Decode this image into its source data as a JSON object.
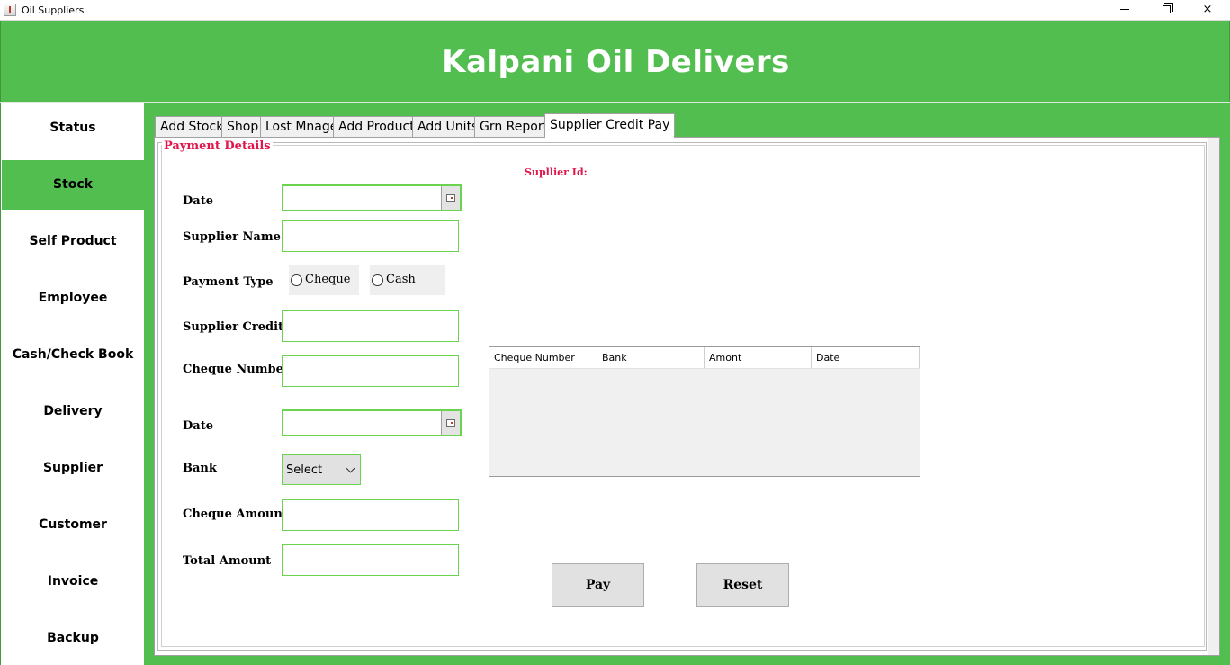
{
  "window": {
    "title": "Oil Suppliers",
    "controls": {
      "minimize": "minimize-icon",
      "maximize": "restore-icon",
      "close": "×"
    }
  },
  "header": {
    "title": "Kalpani Oil Delivers"
  },
  "colors": {
    "brand_green": "#52be4f",
    "accent_red": "#e0174a",
    "field_border": "#6ad34f"
  },
  "sidebar": {
    "items": [
      {
        "label": "Status",
        "active": false
      },
      {
        "label": "Stock",
        "active": true
      },
      {
        "label": "Self Product",
        "active": false
      },
      {
        "label": "Employee",
        "active": false
      },
      {
        "label": "Cash/Check Book",
        "active": false
      },
      {
        "label": "Delivery",
        "active": false
      },
      {
        "label": "Supplier",
        "active": false
      },
      {
        "label": "Customer",
        "active": false
      },
      {
        "label": "Invoice",
        "active": false
      },
      {
        "label": "Backup",
        "active": false
      }
    ]
  },
  "tabs": [
    {
      "label": "Add Stock",
      "selected": false
    },
    {
      "label": "Shop",
      "selected": false
    },
    {
      "label": "Lost Mnage",
      "selected": false
    },
    {
      "label": "Add Product",
      "selected": false
    },
    {
      "label": "Add Units",
      "selected": false
    },
    {
      "label": "Grn Report",
      "selected": false
    },
    {
      "label": "Supplier Credit Pay",
      "selected": true
    }
  ],
  "form": {
    "group_title": "Payment Details",
    "supplier_id_label": "Supllier Id:",
    "date_label": "Date",
    "date_value": "",
    "supplier_name_label": "Supplier Name",
    "supplier_name_value": "",
    "payment_type_label": "Payment Type",
    "payment_options": [
      {
        "label": "Cheque",
        "checked": false
      },
      {
        "label": "Cash",
        "checked": false
      }
    ],
    "supplier_credit_label": "Supplier Credit",
    "supplier_credit_value": "",
    "cheque_number_label": "Cheque Number",
    "cheque_number_value": "",
    "cheque_date_label": "Date",
    "cheque_date_value": "",
    "bank_label": "Bank",
    "bank_selected": "Select",
    "cheque_amount_label": "Cheque Amount",
    "cheque_amount_value": "",
    "total_amount_label": "Total Amount",
    "total_amount_value": ""
  },
  "table": {
    "columns": [
      "Cheque Number",
      "Bank",
      "Amont",
      "Date"
    ],
    "rows": []
  },
  "buttons": {
    "pay": "Pay",
    "reset": "Reset"
  }
}
